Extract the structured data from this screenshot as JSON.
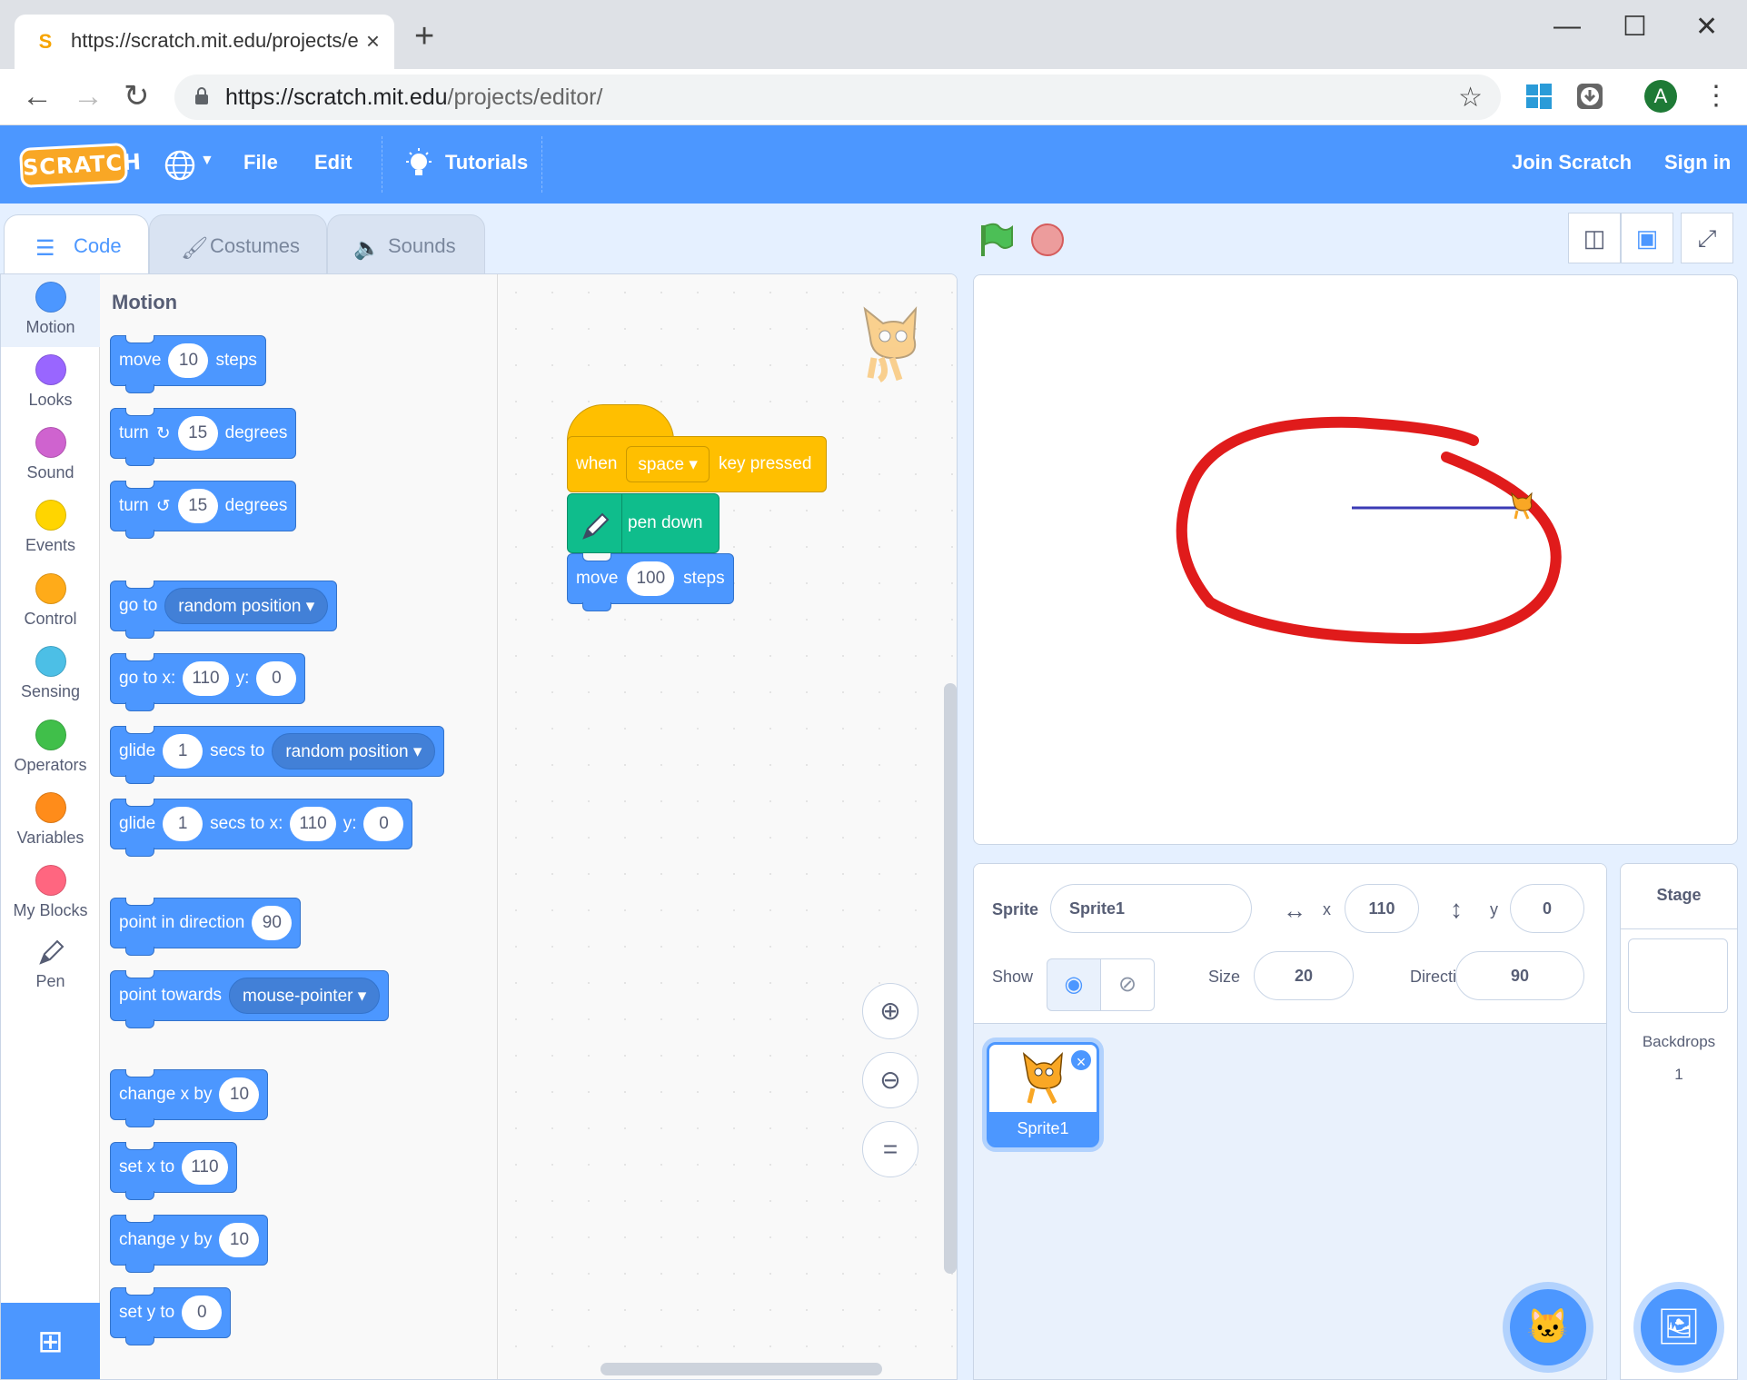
{
  "browser": {
    "tab_title": "https://scratch.mit.edu/projects/e",
    "tab_close": "×",
    "new_tab": "+",
    "url_host": "https://scratch.mit.edu",
    "url_path": "/projects/editor/",
    "avatar_letter": "A",
    "minimize": "—",
    "maximize": "☐",
    "close": "✕"
  },
  "menubar": {
    "logo": "SCRATCH",
    "file": "File",
    "edit": "Edit",
    "tutorials": "Tutorials",
    "join": "Join Scratch",
    "signin": "Sign in",
    "accent": "#4c97ff"
  },
  "editor_tabs": [
    {
      "label": "Code",
      "icon": "code-icon"
    },
    {
      "label": "Costumes",
      "icon": "brush-icon"
    },
    {
      "label": "Sounds",
      "icon": "speaker-icon"
    }
  ],
  "categories": [
    {
      "label": "Motion",
      "color": "#4c97ff"
    },
    {
      "label": "Looks",
      "color": "#9966ff"
    },
    {
      "label": "Sound",
      "color": "#cf63cf"
    },
    {
      "label": "Events",
      "color": "#ffd500"
    },
    {
      "label": "Control",
      "color": "#ffab19"
    },
    {
      "label": "Sensing",
      "color": "#4cbfe6"
    },
    {
      "label": "Operators",
      "color": "#40bf4a"
    },
    {
      "label": "Variables",
      "color": "#ff8c1a"
    },
    {
      "label": "My Blocks",
      "color": "#ff6680"
    },
    {
      "label": "Pen",
      "color": "#0fbd8c"
    }
  ],
  "palette": {
    "title": "Motion",
    "move": {
      "a": "move",
      "v": "10",
      "b": "steps"
    },
    "turn_cw": {
      "a": "turn",
      "v": "15",
      "b": "degrees"
    },
    "turn_ccw": {
      "a": "turn",
      "v": "15",
      "b": "degrees"
    },
    "goto": {
      "a": "go to",
      "d": "random position"
    },
    "gotoxy": {
      "a": "go to x:",
      "x": "110",
      "b": "y:",
      "y": "0"
    },
    "glide": {
      "a": "glide",
      "v": "1",
      "b": "secs to",
      "d": "random position"
    },
    "glidexy": {
      "a": "glide",
      "v": "1",
      "b": "secs to x:",
      "x": "110",
      "c": "y:",
      "y": "0"
    },
    "point": {
      "a": "point in direction",
      "v": "90"
    },
    "towards": {
      "a": "point towards",
      "d": "mouse-pointer"
    },
    "changex": {
      "a": "change x by",
      "v": "10"
    },
    "setx": {
      "a": "set x to",
      "v": "110"
    },
    "changey": {
      "a": "change y by",
      "v": "10"
    },
    "sety": {
      "a": "set y to",
      "v": "0"
    }
  },
  "script": {
    "when": "when",
    "key": "space",
    "pressed": "key pressed",
    "pen_down": "pen down",
    "move": "move",
    "steps_value": "100",
    "steps": "steps"
  },
  "sprite": {
    "sprite_label": "Sprite",
    "name": "Sprite1",
    "x_label": "x",
    "x": "110",
    "y_label": "y",
    "y": "0",
    "show_label": "Show",
    "size_label": "Size",
    "size": "20",
    "direction_label": "Direction",
    "direction": "90",
    "thumb_name": "Sprite1"
  },
  "stage_pane": {
    "title": "Stage",
    "backdrops_label": "Backdrops",
    "backdrops_count": "1"
  }
}
